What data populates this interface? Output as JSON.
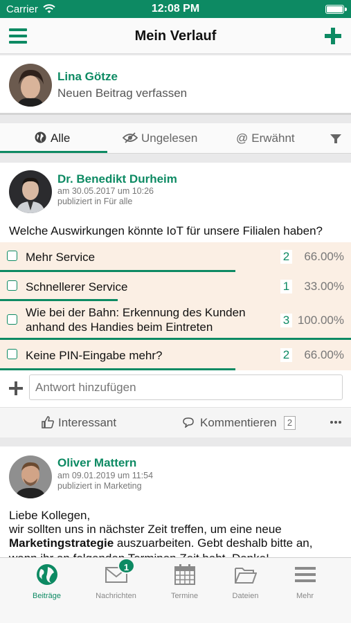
{
  "status_bar": {
    "carrier": "Carrier",
    "time": "12:08 PM"
  },
  "nav": {
    "title": "Mein Verlauf"
  },
  "composer": {
    "user_name": "Lina Götze",
    "prompt": "Neuen Beitrag verfassen"
  },
  "filter_tabs": [
    {
      "label": "Alle",
      "icon": "globe-icon",
      "active": true
    },
    {
      "label": "Ungelesen",
      "icon": "eye-slash-icon",
      "active": false
    },
    {
      "label": "Erwähnt",
      "icon": "at-icon",
      "active": false
    }
  ],
  "post1": {
    "author": "Dr. Benedikt Durheim",
    "date": "am 30.05.2017 um 10:26",
    "published": "publiziert in Für alle",
    "question": "Welche Auswirkungen könnte IoT für unsere Filialen haben?",
    "options": [
      {
        "label": "Mehr Service",
        "count": "2",
        "percent": "66.00%",
        "fraction": 0.66
      },
      {
        "label": "Schnellerer Service",
        "count": "1",
        "percent": "33.00%",
        "fraction": 0.33
      },
      {
        "label_line1": "Wie bei der Bahn: Erkennung des Kunden",
        "label_line2": "anhand des Handies beim Eintreten",
        "count": "3",
        "percent": "100.00%",
        "fraction": 1.0
      },
      {
        "label": "Keine PIN-Eingabe mehr?",
        "count": "2",
        "percent": "66.00%",
        "fraction": 0.66
      }
    ],
    "answer_placeholder": "Antwort hinzufügen",
    "like_label": "Interessant",
    "comment_label": "Kommentieren",
    "comment_count": "2"
  },
  "post2": {
    "author": "Oliver Mattern",
    "date": "am 09.01.2019 um 11:54",
    "published": "publiziert in Marketing",
    "line1": "Liebe Kollegen,",
    "line2": "wir sollten uns in nächster Zeit treffen, um eine neue",
    "line3_bold": "Marketingstrategie",
    "line3_rest": " auszuarbeiten. Gebt deshalb bitte an,",
    "line4_partial": "wann ihr an folgenden Terminen Zeit habt. Danke!"
  },
  "tab_bar": [
    {
      "label": "Beiträge",
      "icon": "globe-icon",
      "active": true
    },
    {
      "label": "Nachrichten",
      "icon": "envelope-icon",
      "badge": "1"
    },
    {
      "label": "Termine",
      "icon": "calendar-icon"
    },
    {
      "label": "Dateien",
      "icon": "folder-icon"
    },
    {
      "label": "Mehr",
      "icon": "menu-icon"
    }
  ],
  "colors": {
    "brand": "#0d8a63",
    "option_bg": "#fbefe4"
  }
}
